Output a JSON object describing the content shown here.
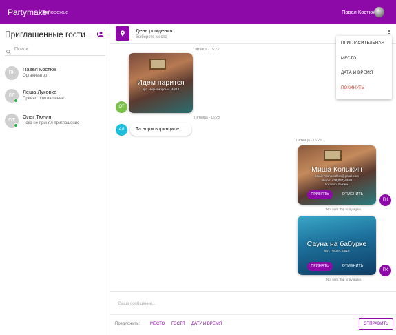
{
  "header": {
    "brand": "Partymaker",
    "city": "Запорожье",
    "user_name": "Павел Костюк"
  },
  "sidebar": {
    "title": "Приглашенные гости",
    "search_placeholder": "Поиск",
    "guests": [
      {
        "initials": "ПК",
        "name": "Павел Костюк",
        "status": "Организатор"
      },
      {
        "initials": "ЛЛ",
        "name": "Леша Луковка",
        "status": "Принял приглашение"
      },
      {
        "initials": "ОТ",
        "name": "Олег Тюнин",
        "status": "Пока не принял приглашение"
      }
    ]
  },
  "event": {
    "title": "День рождения",
    "subtitle": "Выберете место"
  },
  "menu": {
    "items": [
      "ПРИГЛАСИТЕЛЬНАЯ",
      "МЕСТО",
      "ДАТА И ВРЕМЯ",
      "ПОКИНУТЬ"
    ]
  },
  "messages": {
    "ts1": "Пятница - 15:23",
    "card1": {
      "title": "Идем парится",
      "subtitle": "вул. Чорноморська, 46/18",
      "avatar": "ОТ"
    },
    "ts2": "Пятница - 15:23",
    "text_msg": {
      "avatar": "АЛ",
      "text": "Та норм впринципе"
    },
    "ts3": "Пятница - 15:23",
    "card2": {
      "title": "Миша Колыкин",
      "sub1": "email: misha.kolikin@gmail.com",
      "sub2": "phone: +38(097)-8888",
      "sub3": "Location: Бикини",
      "accept": "ПРИНЯТЬ",
      "reject": "ОТМЕНИТЬ",
      "avatar": "ПК",
      "status": "Not sent. Tap to try again."
    },
    "card3": {
      "title": "Сауна на бабурке",
      "subtitle": "вул. Гоголя, 46/18",
      "accept": "ПРИНЯТЬ",
      "reject": "ОТМЕНИТЬ",
      "avatar": "ПК",
      "status": "Not sent. Tap to try again."
    }
  },
  "compose": {
    "placeholder": "Ваше сообщение...",
    "suggest_label": "Предложить:",
    "suggest": [
      "МЕСТО",
      "ГОСТЯ",
      "ДАТУ И ВРЕМЯ"
    ],
    "send": "ОТПРАВИТЬ"
  },
  "colors": {
    "primary": "#8e0aa8",
    "online": "#2db34a",
    "danger": "#e2413a",
    "avatar_ot": "#7cc04b",
    "avatar_al": "#1ebfdc"
  },
  "icons": [
    "add-user-icon",
    "search-icon",
    "location-pin-icon",
    "more-vert-icon"
  ]
}
